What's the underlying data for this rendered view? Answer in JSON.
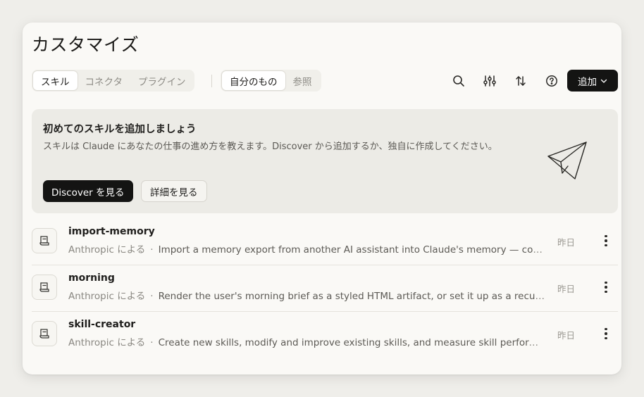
{
  "page": {
    "title": "カスタマイズ"
  },
  "tabs_primary": [
    {
      "label": "スキル",
      "active": true
    },
    {
      "label": "コネクタ",
      "active": false
    },
    {
      "label": "プラグイン",
      "active": false
    }
  ],
  "tabs_filter": [
    {
      "label": "自分のもの",
      "active": true
    },
    {
      "label": "参照",
      "active": false
    }
  ],
  "toolbar": {
    "icons": [
      "search-icon",
      "filter-sliders-icon",
      "sort-icon",
      "help-icon"
    ],
    "add_label": "追加"
  },
  "banner": {
    "title": "初めてのスキルを追加しましょう",
    "description": "スキルは Claude にあなたの仕事の進め方を教えます。Discover から追加するか、独自に作成してください。",
    "primary_button": "Discover を見る",
    "secondary_button": "詳細を見る",
    "illustration": "paper-plane-icon"
  },
  "skills": [
    {
      "name": "import-memory",
      "author": "Anthropic による",
      "separator": "·",
      "description": "Import a memory export from another AI assistant into Claude's memory — conve…",
      "date": "昨日"
    },
    {
      "name": "morning",
      "author": "Anthropic による",
      "separator": "·",
      "description": "Render the user's morning brief as a styled HTML artifact, or set it up as a recurri…",
      "date": "昨日"
    },
    {
      "name": "skill-creator",
      "author": "Anthropic による",
      "separator": "·",
      "description": "Create new skills, modify and improve existing skills, and measure skill performan…",
      "date": "昨日"
    }
  ]
}
